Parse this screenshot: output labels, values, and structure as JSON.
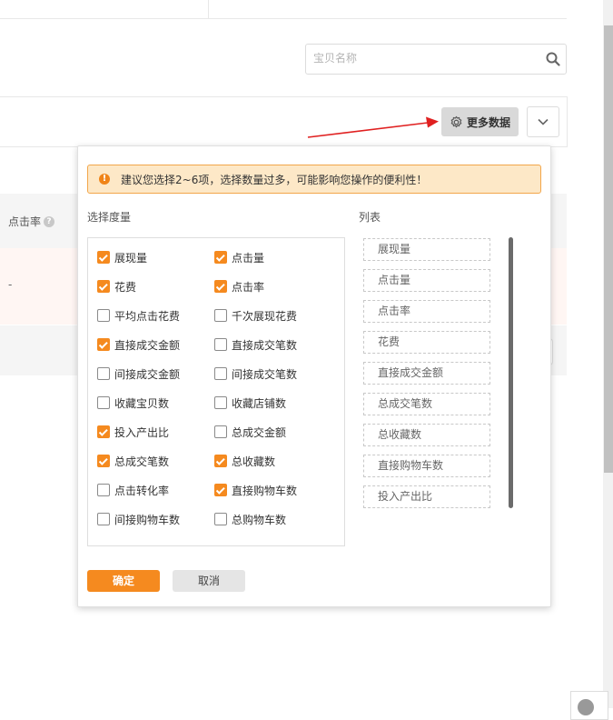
{
  "search": {
    "placeholder": "宝贝名称",
    "icon": "search-icon"
  },
  "toolbar": {
    "more_data_label": "更多数据",
    "more_data_icon": "gear-icon",
    "expand_icon": "chevron-down-icon"
  },
  "table": {
    "column_click_rate": "点击率",
    "help_mark": "?",
    "row_value": "-"
  },
  "popup": {
    "warning_icon": "!",
    "warning": "建议您选择2~6项，选择数量过多，可能影响您操作的便利性！",
    "metrics_title": "选择度量",
    "list_title": "列表",
    "metrics": [
      {
        "label": "展现量",
        "checked": true
      },
      {
        "label": "点击量",
        "checked": true
      },
      {
        "label": "花费",
        "checked": true
      },
      {
        "label": "点击率",
        "checked": true
      },
      {
        "label": "平均点击花费",
        "checked": false
      },
      {
        "label": "千次展现花费",
        "checked": false
      },
      {
        "label": "直接成交金额",
        "checked": true
      },
      {
        "label": "直接成交笔数",
        "checked": false
      },
      {
        "label": "间接成交金额",
        "checked": false
      },
      {
        "label": "间接成交笔数",
        "checked": false
      },
      {
        "label": "收藏宝贝数",
        "checked": false
      },
      {
        "label": "收藏店铺数",
        "checked": false
      },
      {
        "label": "投入产出比",
        "checked": true
      },
      {
        "label": "总成交金额",
        "checked": false
      },
      {
        "label": "总成交笔数",
        "checked": true
      },
      {
        "label": "总收藏数",
        "checked": true
      },
      {
        "label": "点击转化率",
        "checked": false
      },
      {
        "label": "直接购物车数",
        "checked": true
      },
      {
        "label": "间接购物车数",
        "checked": false
      },
      {
        "label": "总购物车数",
        "checked": false
      }
    ],
    "selected_list": [
      "展现量",
      "点击量",
      "点击率",
      "花费",
      "直接成交金额",
      "总成交笔数",
      "总收藏数",
      "直接购物车数",
      "投入产出比"
    ],
    "confirm_label": "确定",
    "cancel_label": "取消"
  },
  "colors": {
    "accent": "#f58a1f",
    "warning_bg": "#fde8c7",
    "annotation_arrow": "#e02020"
  }
}
